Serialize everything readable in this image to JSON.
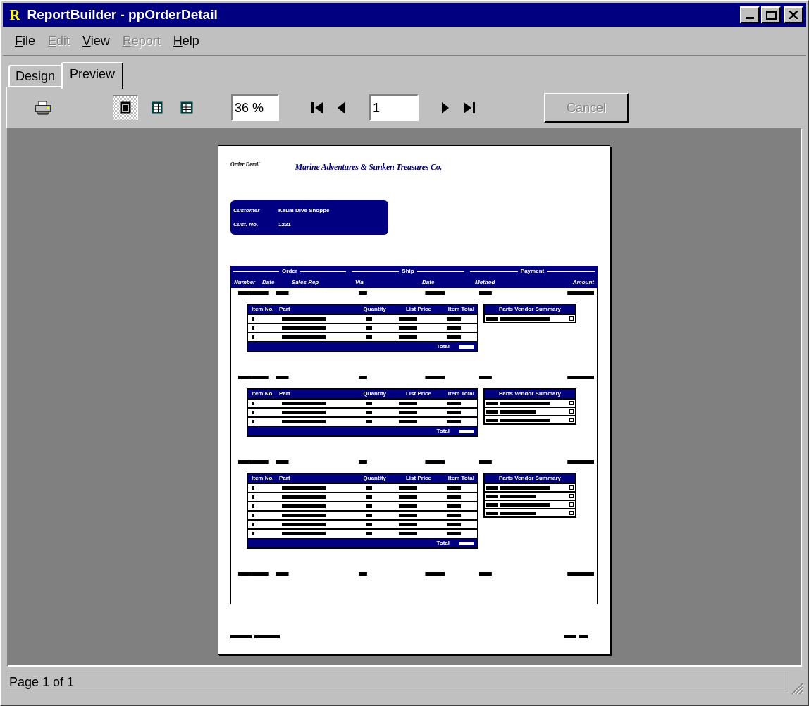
{
  "window": {
    "title": "ReportBuilder - ppOrderDetail",
    "app_icon_letter": "R"
  },
  "menu": [
    {
      "label": "File",
      "disabled": false
    },
    {
      "label": "Edit",
      "disabled": true
    },
    {
      "label": "View",
      "disabled": false
    },
    {
      "label": "Report",
      "disabled": true
    },
    {
      "label": "Help",
      "disabled": false
    }
  ],
  "tabs": [
    {
      "label": "Design",
      "selected": false
    },
    {
      "label": "Preview",
      "selected": true
    }
  ],
  "toolbar": {
    "view_modes": [
      {
        "kind": "page",
        "selected": true
      },
      {
        "kind": "grid",
        "selected": false
      },
      {
        "kind": "columns",
        "selected": false
      }
    ],
    "zoom": "36 %",
    "page": "1",
    "cancel": {
      "label": "Cancel",
      "disabled": true
    }
  },
  "report": {
    "title_left": "Order Detail",
    "company": "Marine Adventures & Sunken Treasures Co.",
    "customer": [
      {
        "label": "Customer",
        "value": "Kauai Dive Shoppe"
      },
      {
        "label": "Cust. No.",
        "value": "1221"
      }
    ],
    "groups": [
      "Order",
      "Ship",
      "Payment"
    ],
    "columns": [
      "Number",
      "Date",
      "Sales Rep",
      "Via",
      "Date",
      "Method",
      "Amount"
    ],
    "orders": [
      {
        "item_columns": [
          "Item No.",
          "Part",
          "Quantity",
          "List Price",
          "Item Total"
        ],
        "total_label": "Total",
        "vendor_title": "Parts Vendor Summary",
        "kind": "with_items",
        "items": [
          {
            "kind": "line"
          },
          {
            "kind": "line"
          },
          {
            "kind": "line"
          }
        ],
        "vendors": [
          {
            "checked": false
          }
        ]
      },
      {
        "item_columns": [
          "Item No.",
          "Part",
          "Quantity",
          "List Price",
          "Item Total"
        ],
        "total_label": "Total",
        "vendor_title": "Parts Vendor Summary",
        "kind": "with_items",
        "items": [
          {
            "kind": "line"
          },
          {
            "kind": "line"
          },
          {
            "kind": "line"
          }
        ],
        "vendors": [
          {
            "checked": false
          },
          {
            "checked": false
          },
          {
            "checked": false
          }
        ]
      },
      {
        "item_columns": [
          "Item No.",
          "Part",
          "Quantity",
          "List Price",
          "Item Total"
        ],
        "total_label": "Total",
        "vendor_title": "Parts Vendor Summary",
        "kind": "with_items",
        "items": [
          {
            "kind": "line"
          },
          {
            "kind": "line"
          },
          {
            "kind": "line"
          },
          {
            "kind": "line"
          },
          {
            "kind": "line"
          },
          {
            "kind": "line"
          }
        ],
        "vendors": [
          {
            "checked": false
          },
          {
            "checked": false
          },
          {
            "checked": false
          },
          {
            "checked": false
          }
        ]
      },
      {
        "kind": "cut"
      }
    ]
  },
  "status_bar": "Page 1 of 1"
}
